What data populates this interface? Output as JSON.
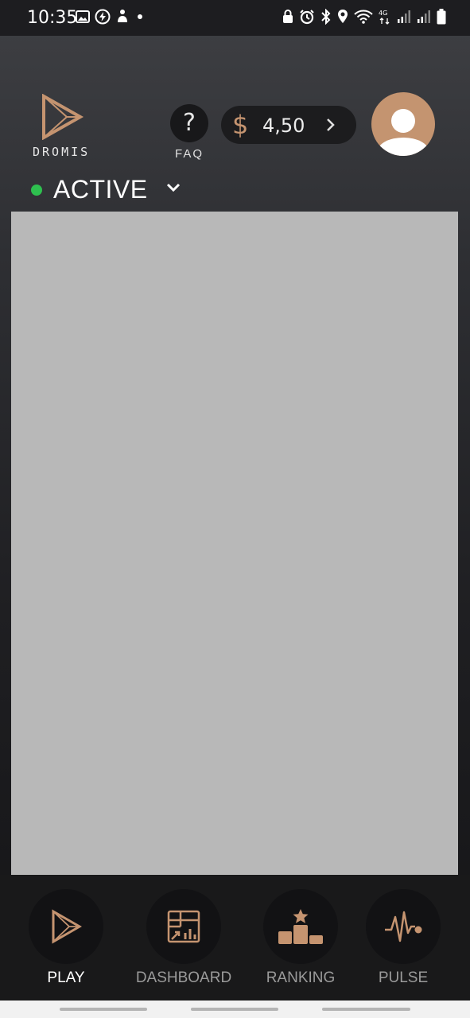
{
  "status_bar": {
    "time": "10:35",
    "left_icons": [
      "image-icon",
      "flash-icon",
      "accessibility-icon",
      "dot-icon"
    ],
    "right_icons": [
      "lock-icon",
      "alarm-icon",
      "bluetooth-icon",
      "location-icon",
      "wifi-icon",
      "signal-4g-icon",
      "signal-icon",
      "signal-icon",
      "battery-icon"
    ],
    "network_label": "4G"
  },
  "header": {
    "logo_text": "DROMIS",
    "faq_glyph": "?",
    "faq_label": "FAQ",
    "balance": {
      "currency": "$",
      "amount": "4,50"
    }
  },
  "status": {
    "label": "ACTIVE",
    "color": "#2ec04f"
  },
  "bottom_nav": {
    "items": [
      {
        "label": "PLAY",
        "icon": "play-icon",
        "active": true
      },
      {
        "label": "DASHBOARD",
        "icon": "dashboard-icon",
        "active": false
      },
      {
        "label": "RANKING",
        "icon": "podium-icon",
        "active": false
      },
      {
        "label": "PULSE",
        "icon": "pulse-icon",
        "active": false
      }
    ]
  },
  "colors": {
    "accent": "#c59470",
    "active_status": "#2ec04f",
    "content_placeholder": "#b8b8b8",
    "nav_background": "#19191a"
  }
}
